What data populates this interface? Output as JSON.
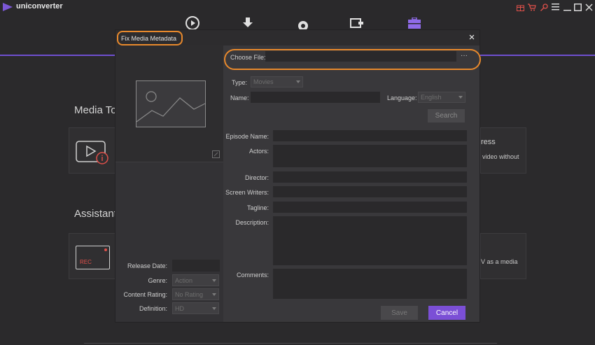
{
  "app": {
    "name": "uniconverter",
    "accent": "#6f4fd0",
    "highlight": "#e8892c"
  },
  "nav": {
    "icons": [
      "convert-icon",
      "download-icon",
      "record-icon",
      "transfer-icon",
      "toolbox-icon"
    ]
  },
  "window_controls": [
    "gift-icon",
    "cart-icon",
    "key-icon",
    "menu-icon",
    "minimize-icon",
    "maximize-icon",
    "close-icon"
  ],
  "background": {
    "section1": "Media Too",
    "section2": "Assistant",
    "card_right1_title": "ress",
    "card_right1_desc": "video without",
    "card_right2_desc": "V as a media",
    "rec_label": "REC"
  },
  "modal": {
    "title": "Fix Media Metadata",
    "close": "×",
    "choose_file_label": "Choose File:",
    "choose_file_value": "",
    "browse": "···",
    "type_label": "Type:",
    "type_value": "Movies",
    "name_label": "Name:",
    "name_value": "",
    "language_label": "Language:",
    "language_value": "English",
    "search": "Search",
    "episode_label": "Episode Name:",
    "actors_label": "Actors:",
    "director_label": "Director:",
    "writers_label": "Screen Writers:",
    "tagline_label": "Tagline:",
    "description_label": "Description:",
    "comments_label": "Comments:",
    "release_label": "Release Date:",
    "release_value": "",
    "genre_label": "Genre:",
    "genre_value": "Action",
    "rating_label": "Content Rating:",
    "rating_value": "No Rating",
    "definition_label": "Definition:",
    "definition_value": "HD",
    "save": "Save",
    "cancel": "Cancel"
  }
}
